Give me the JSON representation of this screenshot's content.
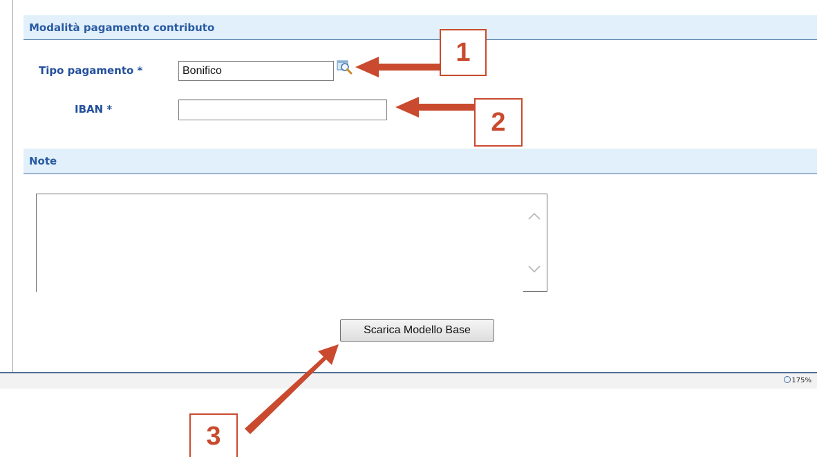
{
  "sections": {
    "payment_header": "Modalità pagamento contributo",
    "notes_header": "Note"
  },
  "form": {
    "tipo_pagamento_label": "Tipo pagamento *",
    "tipo_pagamento_value": "Bonifico",
    "iban_label": "IBAN *",
    "iban_value": "",
    "notes_value": ""
  },
  "buttons": {
    "download_label": "Scarica Modello Base"
  },
  "status_bar": {
    "zoom_level": "175%"
  },
  "annotations": {
    "callout_1": "1",
    "callout_2": "2",
    "callout_3": "3"
  },
  "icons": {
    "lookup": "search-icon",
    "scroll_up": "chevron-up-icon",
    "scroll_down": "chevron-down-icon",
    "zoom": "zoom-icon"
  },
  "colors": {
    "header_bg": "#e1f0fb",
    "label_blue": "#224f9a",
    "annotation_red": "#c94a2e"
  }
}
